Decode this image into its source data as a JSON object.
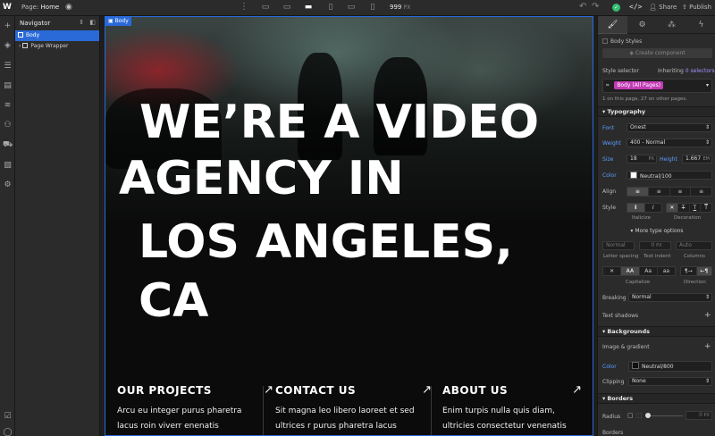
{
  "topbar": {
    "logo": "W",
    "page_prefix": "Page:",
    "page_name": "Home",
    "width_value": "999",
    "width_unit": "PX",
    "share": "Share",
    "publish": "Publish",
    "code": "</>"
  },
  "navigator": {
    "title": "Navigator",
    "items": [
      {
        "label": "Body",
        "selected": true
      },
      {
        "label": "Page Wrapper",
        "selected": false
      }
    ]
  },
  "canvas": {
    "tag": "Body",
    "hero_lines": [
      "WE’RE A VIDEO",
      "AGENCY IN",
      "LOS ANGELES,",
      "CA"
    ],
    "cards": [
      {
        "title": "OUR PROJECTS",
        "line1": "Arcu eu integer purus pharetra",
        "line2": "lacus roin viverr enenatis"
      },
      {
        "title": "CONTACT US",
        "line1": "Sit magna leo libero laoreet et sed",
        "line2": "ultrices r purus pharetra lacus"
      },
      {
        "title": "ABOUT US",
        "line1": "Enim turpis nulla quis diam,",
        "line2": "ultricies consectetur venenatis"
      }
    ]
  },
  "panel": {
    "body_styles": "Body Styles",
    "create_component": "Create component",
    "style_selector": "Style selector",
    "inheriting_prefix": "Inheriting",
    "inheriting_count": "0",
    "inheriting_suffix": "selectors",
    "selector_value": "Body (All Pages)",
    "selector_note": "1 on this page, 27 on other pages.",
    "typography": "Typography",
    "font_label": "Font",
    "font_value": "Onest",
    "weight_label": "Weight",
    "weight_value": "400 - Normal",
    "size_label": "Size",
    "size_value": "18",
    "size_unit": "PX",
    "height_label": "Height",
    "height_value": "1.667",
    "height_unit": "EM",
    "color_label": "Color",
    "color_value": "Neutral/100",
    "align_label": "Align",
    "style_label": "Style",
    "italicize": "Italicize",
    "decoration": "Decoration",
    "more_type": "More type options",
    "ls_value": "Normal",
    "ti_value": "0",
    "ti_unit": "PX",
    "col_value": "Auto",
    "letter_spacing": "Letter spacing",
    "text_indent": "Text indent",
    "columns": "Columns",
    "capitalize": "Capitalize",
    "direction": "Direction",
    "breaking_label": "Breaking",
    "breaking_value": "Normal",
    "text_shadows": "Text shadows",
    "backgrounds": "Backgrounds",
    "image_gradient": "Image & gradient",
    "bg_color_label": "Color",
    "bg_color_value": "Neutral/800",
    "clipping_label": "Clipping",
    "clipping_value": "None",
    "borders": "Borders",
    "radius_label": "Radius",
    "radius_value": "0",
    "radius_unit": "PX",
    "borders_sub": "Borders"
  },
  "colors": {
    "accent": "#2a6ad8",
    "selector_pill": "#c23bb5",
    "status_green": "#2fbf71"
  }
}
